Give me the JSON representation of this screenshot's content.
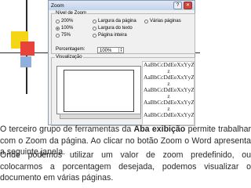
{
  "dialog": {
    "title": "Zoom",
    "zoom_group_label": "Nível de Zoom",
    "options": {
      "z200": "200%",
      "z100": "100%",
      "z75": "75%",
      "page_width": "Largura da página",
      "text_width": "Largura do texto",
      "whole_page": "Página inteira",
      "multiple_pages": "Várias páginas"
    },
    "selected_option": "100%",
    "percent_label": "Porcentagem:",
    "percent_value": "100%",
    "preview_group_label": "Visualização",
    "preview_lines": [
      "AaBbCcDdEeXxYyZ",
      "z",
      "AaBbCcDdEeXxYyZ",
      "z",
      "AaBbCcDdEeXxYyZ",
      "z",
      "AaBbCcDdEeXxYyZ",
      "z",
      "AaBbCcDdEeXxYyZ"
    ]
  },
  "text": {
    "p1_before": "O terceiro grupo de ferramentas da ",
    "p1_bold": "Aba exibição",
    "p1_after": " permite trabalhar com o Zoom da página. Ao clicar no botão Zoom o Word apresenta a seguinte janela.",
    "p2": "Onde podemos utilizar um valor de zoom predefinido, ou colocarmos a porcentagem desejada, podemos visualizar o documento em várias páginas."
  },
  "colors": {
    "yellow_square": "#f5d617",
    "red_square": "#e8433a",
    "blue_square": "#8fb0dc"
  }
}
